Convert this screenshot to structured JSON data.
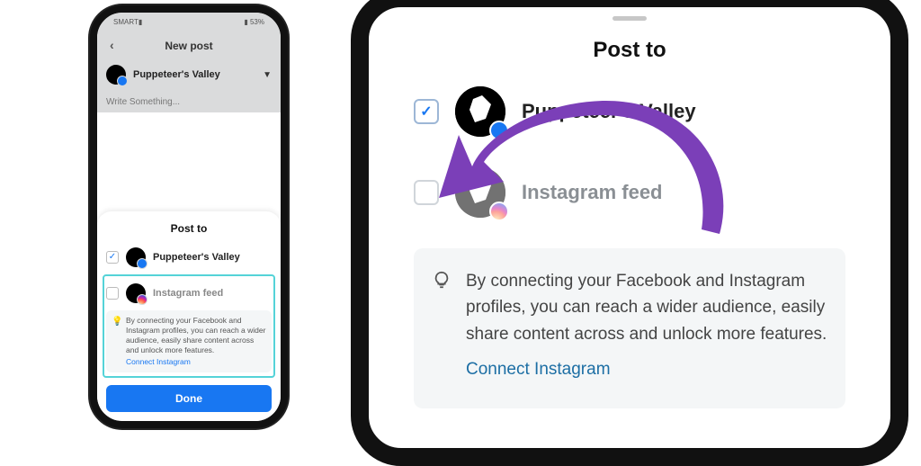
{
  "phone": {
    "statusbar": {
      "carrier": "SMART▮",
      "battery": "▮ 53%"
    },
    "nav": {
      "title": "New post"
    },
    "account": {
      "name": "Puppeteer's Valley"
    },
    "compose_placeholder": "Write Something...",
    "sheet": {
      "title": "Post to",
      "dest_fb": {
        "label": "Puppeteer's Valley",
        "checked": true
      },
      "dest_ig": {
        "label": "Instagram feed",
        "checked": false
      },
      "tip": "By connecting your Facebook and Instagram profiles, you can reach a wider audience, easily share content across and unlock more features.",
      "tip_link": "Connect Instagram",
      "done_label": "Done"
    }
  },
  "zoom": {
    "title": "Post to",
    "dest_fb": {
      "label": "Puppeteer's Valley"
    },
    "dest_ig": {
      "label": "Instagram feed"
    },
    "tip": "By connecting your Facebook and Instagram profiles, you can reach a wider audience, easily share content across and unlock more features.",
    "tip_link": "Connect Instagram"
  },
  "colors": {
    "fb_blue": "#1877f2",
    "highlight_teal": "#55d3d8",
    "arrow_purple": "#7b3fb8"
  }
}
